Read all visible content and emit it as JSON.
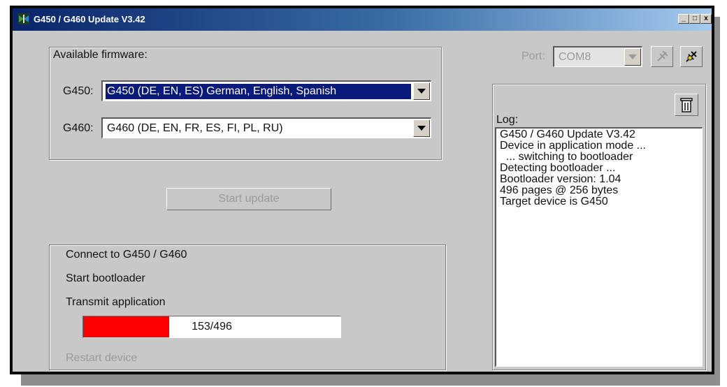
{
  "window": {
    "title": "G450 / G460 Update V3.42",
    "controls": {
      "minimize": "_",
      "maximize": "□",
      "close": "x"
    }
  },
  "firmware": {
    "group_label": "Available firmware:",
    "g450_label": "G450:",
    "g450_value": "G450 (DE, EN, ES)   German, English, Spanish",
    "g460_label": "G460:",
    "g460_value": "G460 (DE, EN, FR, ES, FI, PL, RU)"
  },
  "port": {
    "label": "Port:",
    "value": "COM8",
    "icons": [
      "disconnect-icon",
      "connect-icon"
    ]
  },
  "actions": {
    "start_update": "Start update"
  },
  "steps": {
    "connect": "Connect to G450 / G460",
    "start_bootloader": "Start bootloader",
    "transmit": "Transmit application",
    "restart": "Restart device"
  },
  "progress": {
    "text": "153/496",
    "fraction": 0.333,
    "fill_color": "#ff0000"
  },
  "log": {
    "label": "Log:",
    "clear_icon": "trash-icon",
    "lines": [
      "G450 / G460 Update V3.42",
      "Device in application mode ...",
      "  ... switching to bootloader",
      "Detecting bootloader ...",
      "Bootloader version: 1.04",
      "496 pages @ 256 bytes",
      "Target device is G450"
    ]
  }
}
